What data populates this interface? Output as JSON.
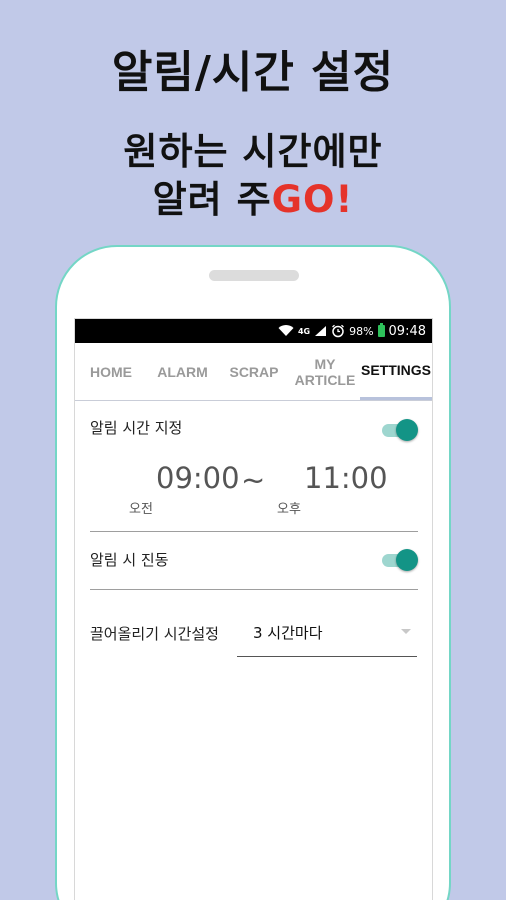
{
  "promo": {
    "title": "알림/시간 설정",
    "subtitle_line1": "원하는 시간에만",
    "subtitle_line2_prefix": "알려 주",
    "subtitle_line2_accent": "GO!"
  },
  "colors": {
    "background": "#c1c9e8",
    "accent_red": "#e5332a",
    "toggle_on": "#139486",
    "phone_border": "#74d6c6"
  },
  "status_bar": {
    "battery": "98%",
    "time": "09:48",
    "network": "4G",
    "icons": [
      "wifi-icon",
      "signal-icon",
      "alarm-clock-icon",
      "battery-icon"
    ]
  },
  "tabs": [
    {
      "label": "HOME",
      "active": false
    },
    {
      "label": "ALARM",
      "active": false
    },
    {
      "label": "SCRAP",
      "active": false
    },
    {
      "label": "MY ARTICLE",
      "active": false
    },
    {
      "label": "SETTINGS",
      "active": true
    }
  ],
  "settings": {
    "alarm_time": {
      "label": "알림 시간 지정",
      "enabled": true,
      "start_time": "09:00",
      "separator": "~",
      "end_time": "11:00",
      "start_period": "오전",
      "end_period": "오후"
    },
    "vibrate": {
      "label": "알림 시 진동",
      "enabled": true
    },
    "pull_interval": {
      "label": "끌어올리기 시간설정",
      "value": "3 시간마다"
    }
  }
}
